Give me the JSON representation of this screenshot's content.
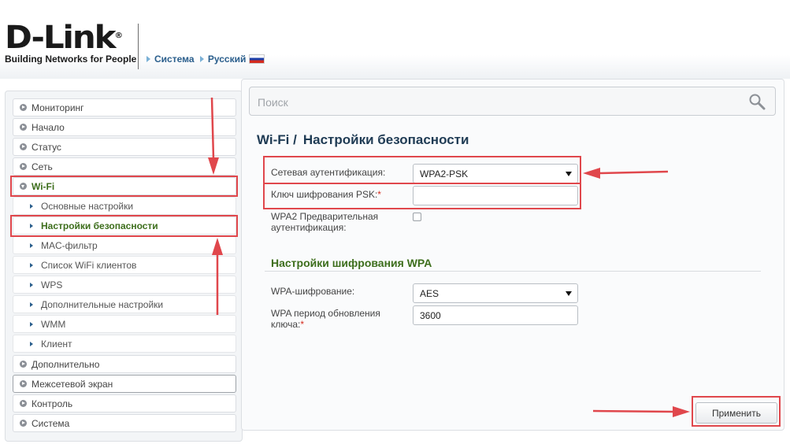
{
  "brand": {
    "logo": "D-Link",
    "logo_mark": "®",
    "tagline": "Building Networks for People"
  },
  "topnav": {
    "system_label": "Система",
    "language_label": "Русский",
    "language_flag": "russia-flag"
  },
  "sidebar": {
    "items": [
      {
        "label": "Мониторинг"
      },
      {
        "label": "Начало"
      },
      {
        "label": "Статус"
      },
      {
        "label": "Сеть"
      },
      {
        "label": "Wi-Fi",
        "active": true,
        "expanded": true
      },
      {
        "label": "Дополнительно"
      },
      {
        "label": "Межсетевой экран"
      },
      {
        "label": "Контроль"
      },
      {
        "label": "Система"
      }
    ],
    "wifi_subitems": [
      {
        "label": "Основные настройки"
      },
      {
        "label": "Настройки безопасности",
        "active": true
      },
      {
        "label": "MAC-фильтр"
      },
      {
        "label": "Список WiFi клиентов"
      },
      {
        "label": "WPS"
      },
      {
        "label": "Дополнительные настройки"
      },
      {
        "label": "WMM"
      },
      {
        "label": "Клиент"
      }
    ]
  },
  "search": {
    "placeholder": "Поиск",
    "value": ""
  },
  "page": {
    "breadcrumb": "Wi-Fi /",
    "title": "Настройки безопасности"
  },
  "form": {
    "auth": {
      "label": "Сетевая аутентификация:",
      "value": "WPA2-PSK"
    },
    "psk": {
      "label": "Ключ шифрования PSK:",
      "required_mark": "*",
      "value": ""
    },
    "preauth": {
      "label_line1": "WPA2 Предварительная",
      "label_line2": "аутентификация:",
      "checked": false
    },
    "wpa_section": {
      "title": "Настройки шифрования WPA"
    },
    "wpa_encryption": {
      "label": "WPA-шифрование:",
      "value": "AES"
    },
    "key_period": {
      "label_line1": "WPA период обновления",
      "label_line2": "ключа:",
      "required_mark": "*",
      "value": "3600"
    },
    "apply_label": "Применить"
  },
  "colors": {
    "accent_green": "#3d6e1c",
    "link_blue": "#2a5e8c",
    "annotation_red": "#e0474c"
  }
}
